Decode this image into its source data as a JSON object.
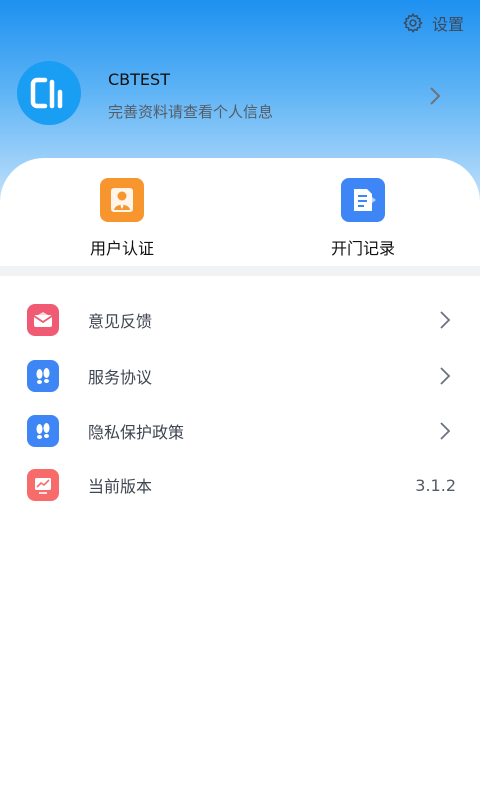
{
  "header": {
    "settings_label": "设置",
    "settings_icon": "gear-icon",
    "gradient_top": "#1e90f0",
    "gradient_bottom": "#bfe0fb"
  },
  "profile": {
    "avatar_icon": "app-logo-avatar",
    "avatar_color": "#1a9ef3",
    "username": "CBTEST",
    "subtitle": "完善资料请查看个人信息"
  },
  "quick_actions": [
    {
      "label": "用户认证",
      "icon": "user-certification-icon",
      "color": "#f7952f"
    },
    {
      "label": "开门记录",
      "icon": "door-record-document-icon",
      "color": "#3e86f5"
    }
  ],
  "menu": [
    {
      "label": "意见反馈",
      "icon": "feedback-mail-icon",
      "color": "#f05a72"
    },
    {
      "label": "服务协议",
      "icon": "footprints-icon",
      "color": "#3e86f5"
    },
    {
      "label": "隐私保护政策",
      "icon": "footprints-icon",
      "color": "#3e86f5"
    },
    {
      "label": "当前版本",
      "icon": "version-chart-icon",
      "color": "#f76b6b",
      "value": "3.1.2"
    }
  ]
}
